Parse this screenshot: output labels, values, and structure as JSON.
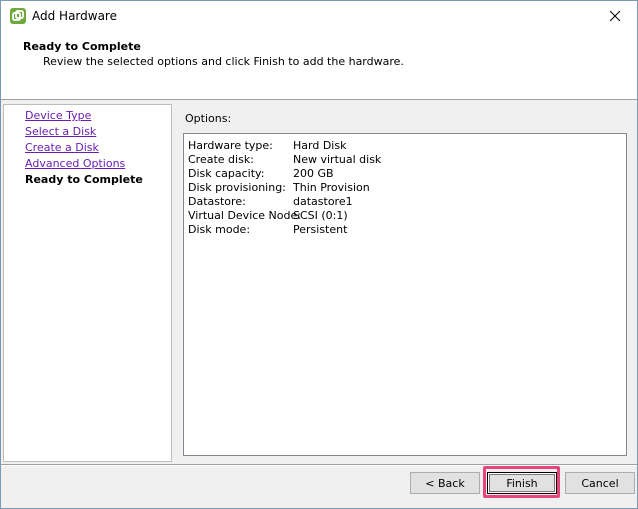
{
  "window": {
    "title": "Add Hardware",
    "icon": "vsphere-logo-icon",
    "accent": "#6fa83a"
  },
  "header": {
    "title": "Ready to Complete",
    "description": "Review the selected options and click Finish to add the hardware."
  },
  "nav": {
    "items": [
      {
        "label": "Device Type",
        "current": false
      },
      {
        "label": "Select a Disk",
        "current": false
      },
      {
        "label": "Create a Disk",
        "current": false
      },
      {
        "label": "Advanced Options",
        "current": false
      },
      {
        "label": "Ready to Complete",
        "current": true
      }
    ],
    "link_color": "#6b1fb1"
  },
  "options": {
    "label": "Options:",
    "rows": [
      {
        "key": "Hardware type:",
        "value": "Hard Disk"
      },
      {
        "key": "Create disk:",
        "value": "New virtual disk"
      },
      {
        "key": "Disk capacity:",
        "value": "200 GB"
      },
      {
        "key": "Disk provisioning:",
        "value": "Thin Provision"
      },
      {
        "key": "Datastore:",
        "value": "datastore1"
      },
      {
        "key": "Virtual Device Node:",
        "value": "SCSI (0:1)"
      },
      {
        "key": "Disk mode:",
        "value": "Persistent"
      }
    ]
  },
  "buttons": {
    "back_label": "< Back",
    "finish_label": "Finish",
    "cancel_label": "Cancel"
  },
  "highlight_color": "#e8467a"
}
